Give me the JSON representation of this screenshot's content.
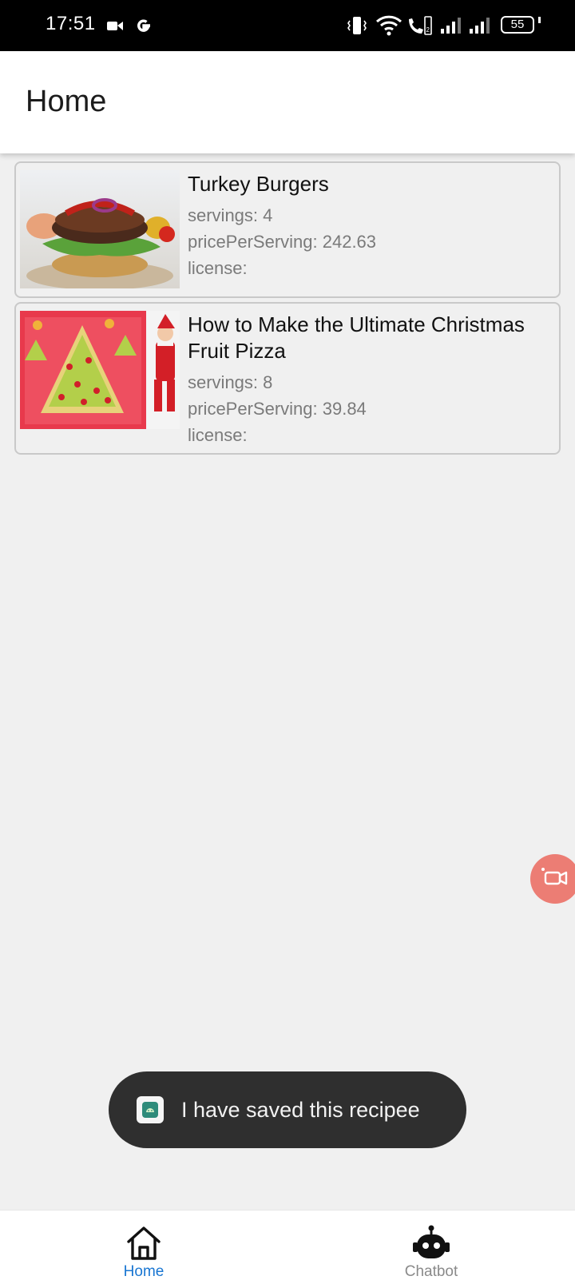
{
  "status_bar": {
    "time": "17:51",
    "battery": "55",
    "icons": [
      "video-camera-icon",
      "google-icon",
      "vibrate-icon",
      "wifi-icon",
      "wifi-calling-icon",
      "signal-icon",
      "signal-icon",
      "battery-icon"
    ]
  },
  "app_bar": {
    "title": "Home"
  },
  "recipes": [
    {
      "title": "Turkey Burgers",
      "servings": "servings: 4",
      "price": "pricePerServing: 242.63",
      "license": "license:"
    },
    {
      "title": "How to Make the Ultimate Christmas Fruit Pizza",
      "servings": "servings: 8",
      "price": "pricePerServing: 39.84",
      "license": "license:"
    }
  ],
  "fab": {
    "icon": "screen-record-icon",
    "color": "#ec7d74"
  },
  "toast": {
    "text": "I have saved this recipee",
    "icon": "android-app-icon"
  },
  "bottom_nav": {
    "items": [
      {
        "label": "Home",
        "icon": "home-icon",
        "active": true,
        "color": "#1976d2"
      },
      {
        "label": "Chatbot",
        "icon": "robot-icon",
        "active": false,
        "color": "#8a8a8a"
      }
    ]
  }
}
